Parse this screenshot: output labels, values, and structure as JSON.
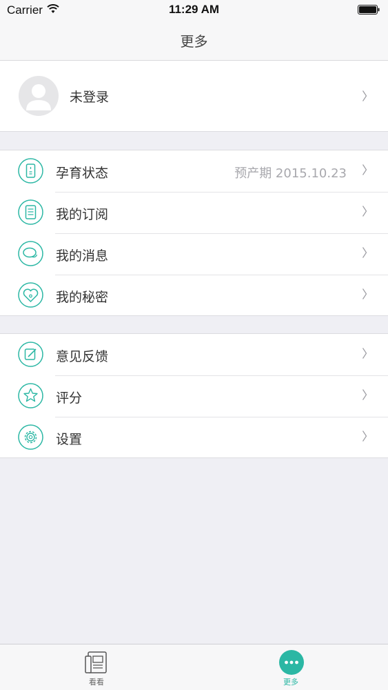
{
  "status_bar": {
    "carrier": "Carrier",
    "time": "11:29 AM"
  },
  "nav": {
    "title": "更多"
  },
  "profile": {
    "name": "未登录",
    "icon": "avatar-placeholder-icon"
  },
  "group_a": [
    {
      "label": "孕育状态",
      "value": "预产期 2015.10.23",
      "icon": "pregnancy-status-icon"
    },
    {
      "label": "我的订阅",
      "value": "",
      "icon": "subscription-icon"
    },
    {
      "label": "我的消息",
      "value": "",
      "icon": "message-icon"
    },
    {
      "label": "我的秘密",
      "value": "",
      "icon": "secret-heart-icon"
    }
  ],
  "group_b": [
    {
      "label": "意见反馈",
      "value": "",
      "icon": "feedback-icon"
    },
    {
      "label": "评分",
      "value": "",
      "icon": "star-icon"
    },
    {
      "label": "设置",
      "value": "",
      "icon": "gear-icon"
    }
  ],
  "tabs": [
    {
      "label": "看看",
      "icon": "news-icon",
      "selected": false
    },
    {
      "label": "更多",
      "icon": "more-icon",
      "selected": true
    }
  ],
  "colors": {
    "accent": "#2bb7a4",
    "background": "#efeff4",
    "chevron": "#9a9aa0"
  }
}
